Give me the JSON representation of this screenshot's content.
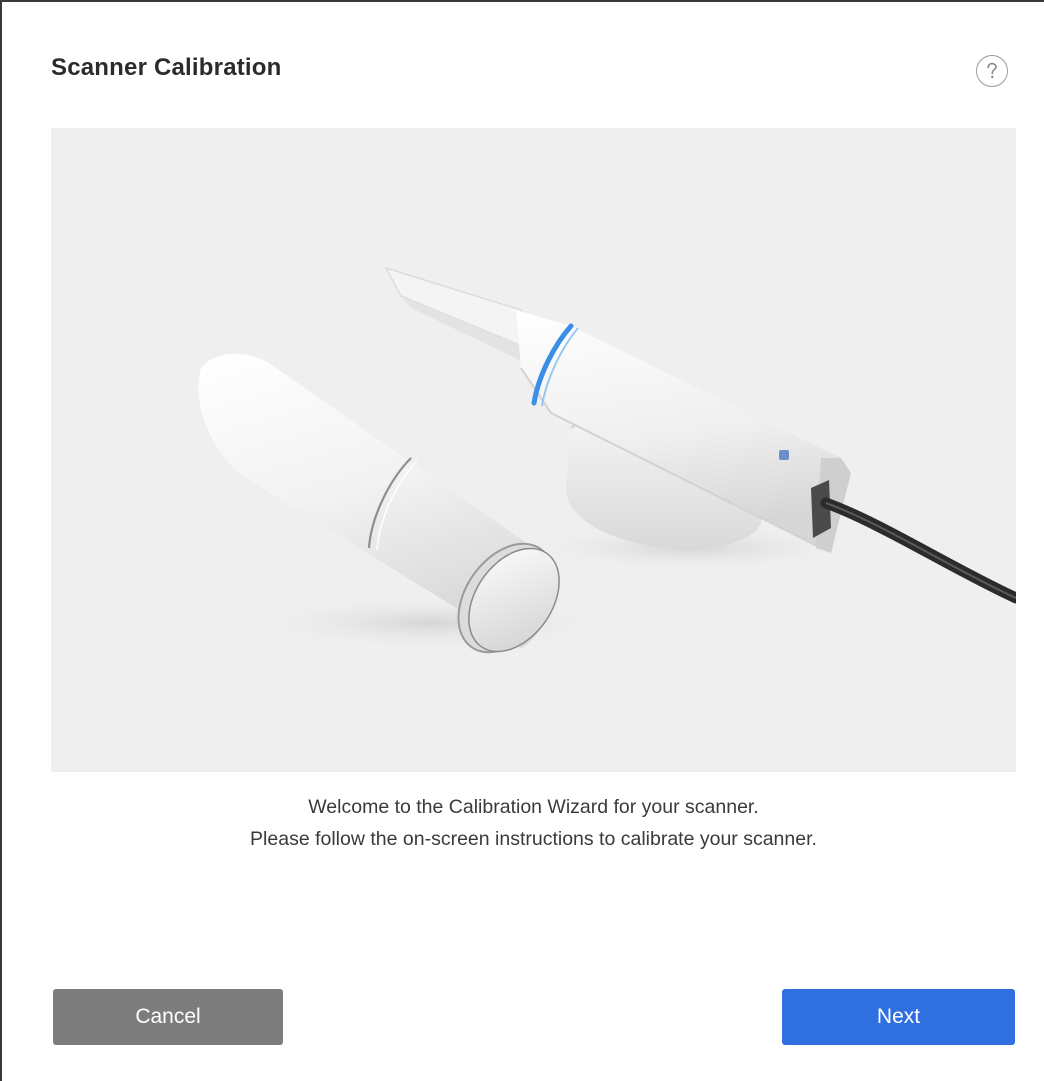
{
  "dialog": {
    "title": "Scanner Calibration",
    "help_icon": "question-circle-icon",
    "illustration": "intraoral-scanner-with-calibration-tool",
    "message_line1": "Welcome to the Calibration Wizard for your scanner.",
    "message_line2": "Please follow the on-screen instructions to calibrate your scanner.",
    "cancel_label": "Cancel",
    "next_label": "Next"
  },
  "colors": {
    "primary_button": "#2f6fe0",
    "secondary_button": "#7d7d7d",
    "illustration_background": "#efefef",
    "scanner_accent": "#3a8ee6"
  }
}
